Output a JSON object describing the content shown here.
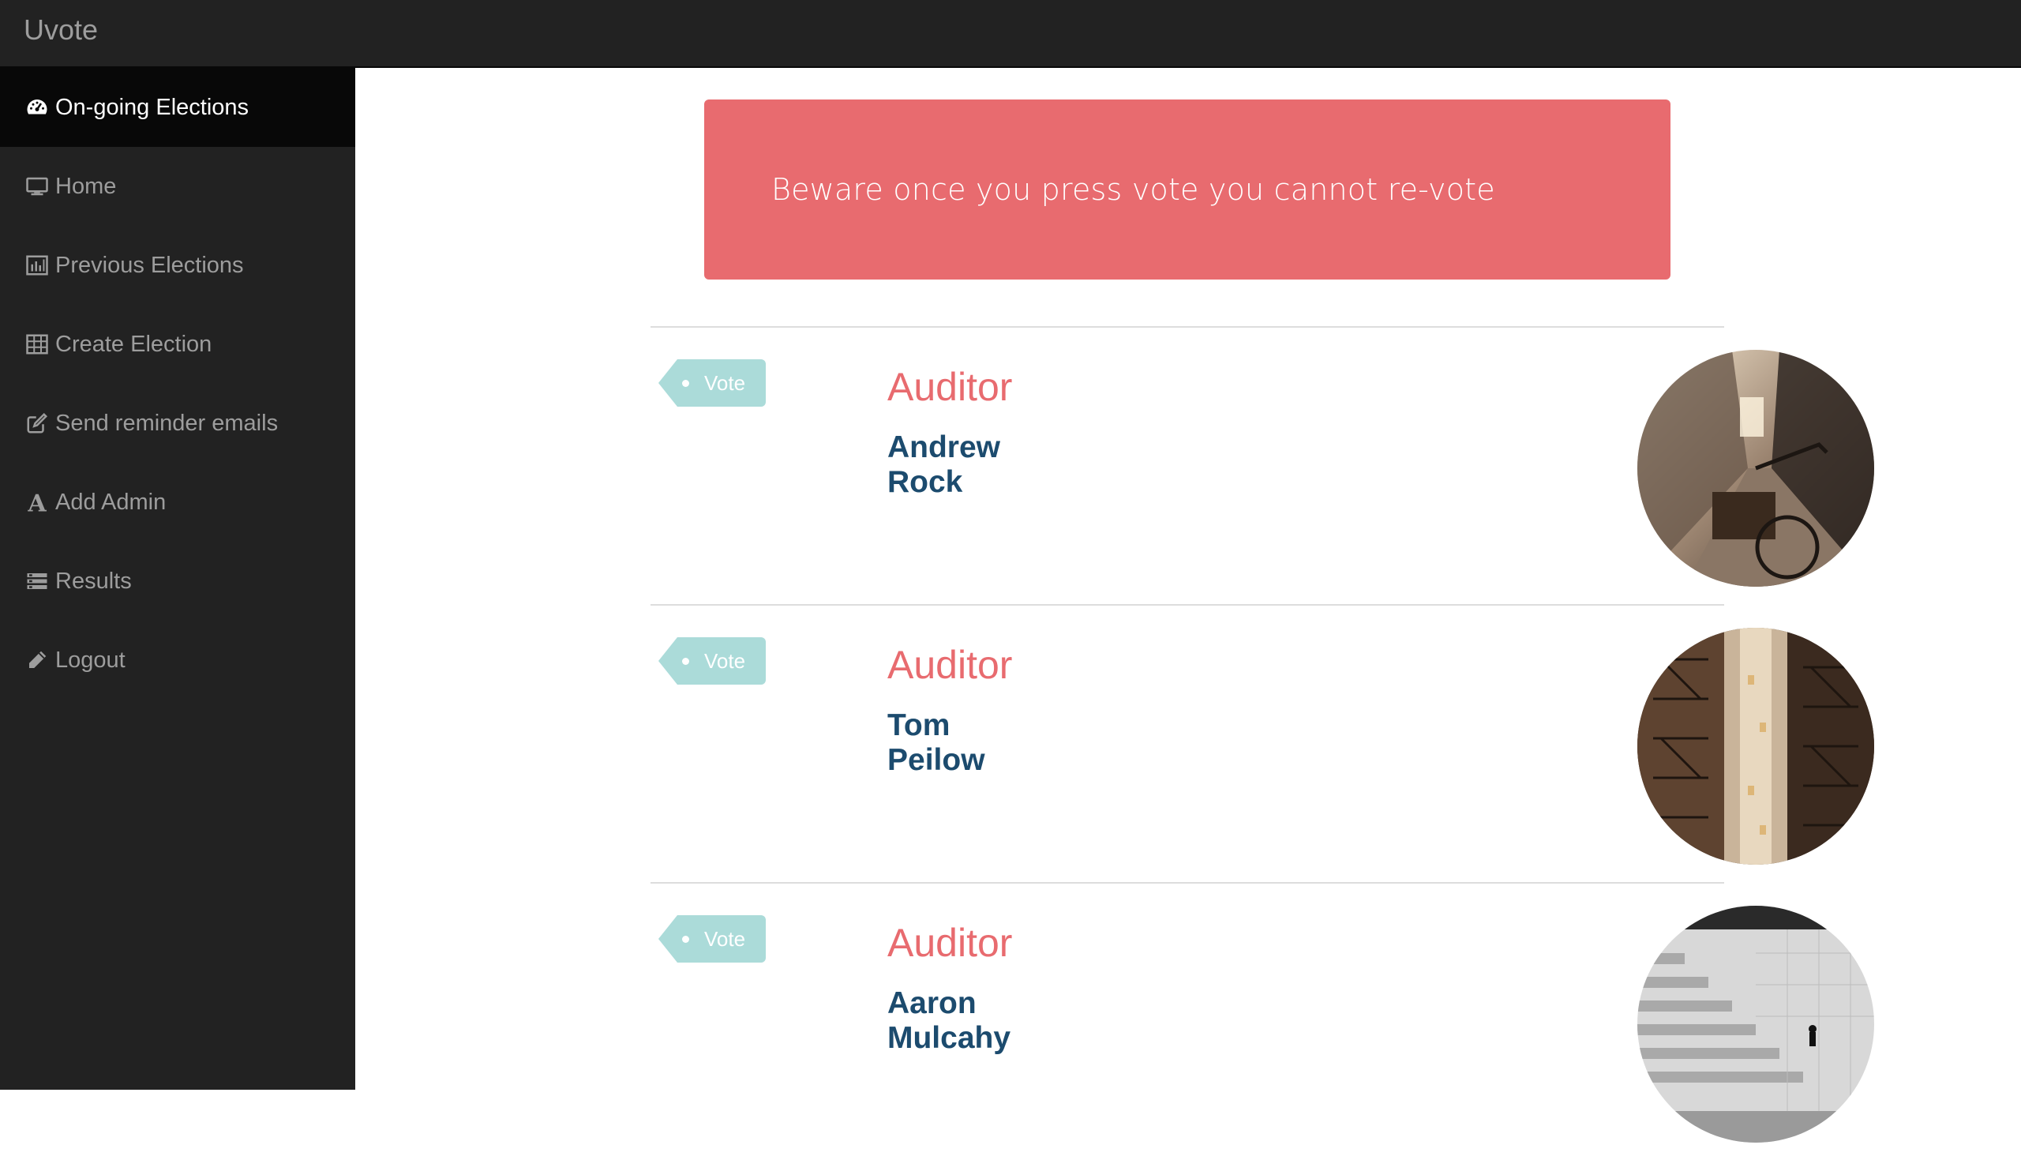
{
  "app": {
    "title": "Uvote"
  },
  "sidebar": {
    "items": [
      {
        "label": "On-going Elections",
        "icon": "dashboard-icon",
        "active": true
      },
      {
        "label": "Home",
        "icon": "desktop-icon",
        "active": false
      },
      {
        "label": "Previous Elections",
        "icon": "bar-chart-icon",
        "active": false
      },
      {
        "label": "Create Election",
        "icon": "table-icon",
        "active": false
      },
      {
        "label": "Send reminder emails",
        "icon": "edit-icon",
        "active": false
      },
      {
        "label": "Add Admin",
        "icon": "font-icon",
        "active": false
      },
      {
        "label": "Results",
        "icon": "list-icon",
        "active": false
      },
      {
        "label": "Logout",
        "icon": "pencil-icon",
        "active": false
      }
    ]
  },
  "alert": {
    "text": "Beware once you press vote you cannot re-vote"
  },
  "candidates": [
    {
      "vote_label": "Vote",
      "role": "Auditor",
      "first_name": "Andrew",
      "last_name": "Rock",
      "photo": "street-bicycle-photo"
    },
    {
      "vote_label": "Vote",
      "role": "Auditor",
      "first_name": "Tom",
      "last_name": "Peilow",
      "photo": "fire-escape-buildings-photo"
    },
    {
      "vote_label": "Vote",
      "role": "Auditor",
      "first_name": "Aaron",
      "last_name": "Mulcahy",
      "photo": "stone-stairs-photo"
    }
  ],
  "colors": {
    "navbar": "#222222",
    "accent": "#e86b6f",
    "vote_tag": "#abdbd9",
    "name": "#1c4b6e"
  }
}
